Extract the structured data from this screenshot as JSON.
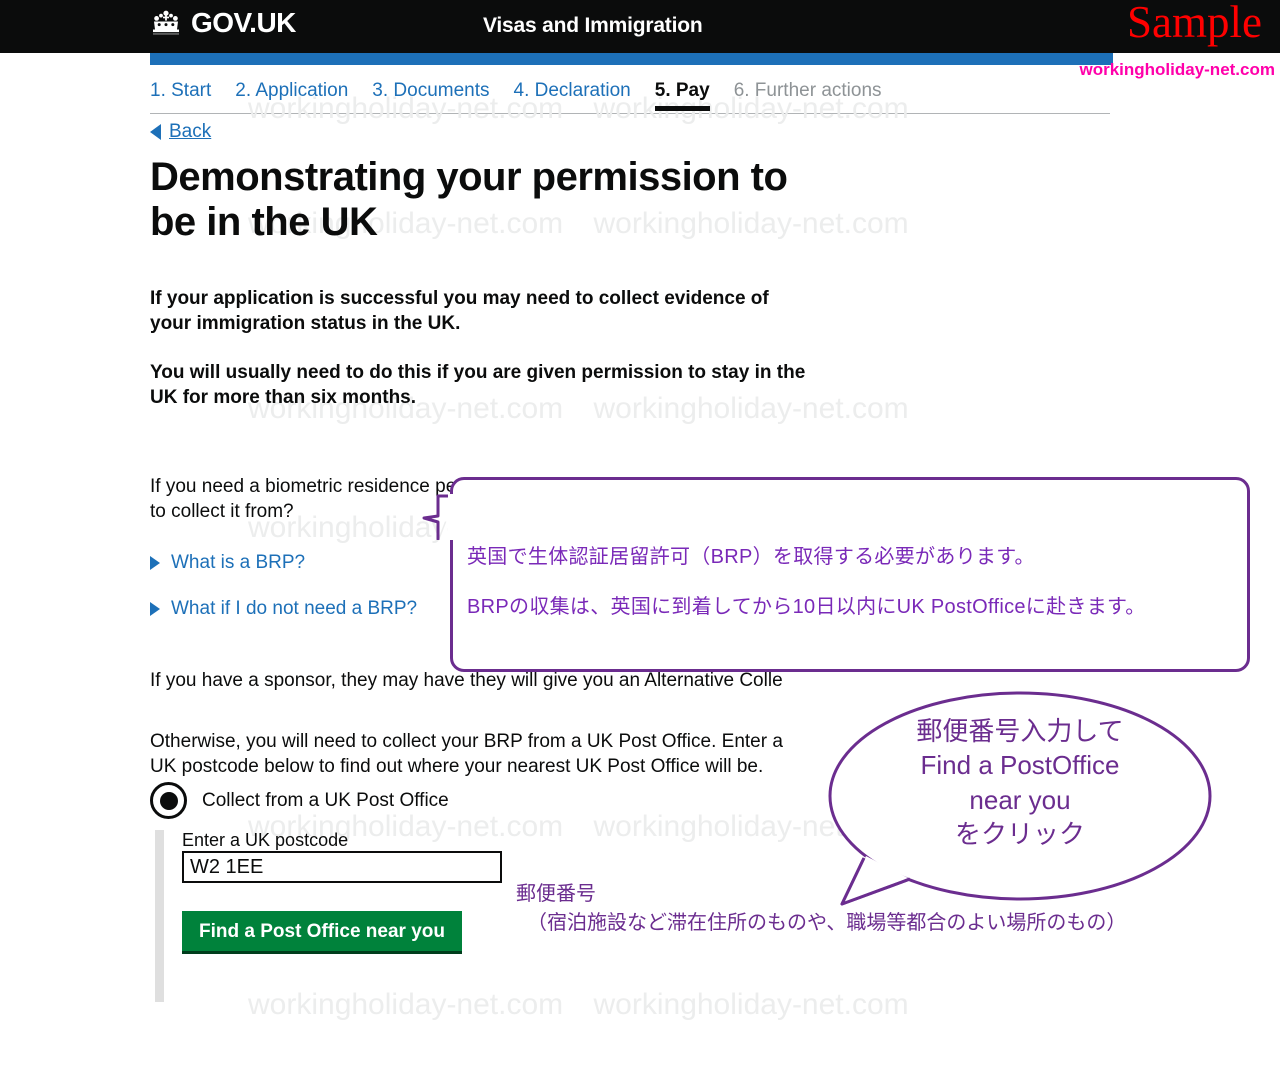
{
  "header": {
    "brand": "GOV.UK",
    "crown_icon": "crown-icon",
    "service_name": "Visas and Immigration",
    "sample_watermark": "Sample",
    "site_watermark": "workingholiday-net.com",
    "brand_bar_color": "#1d70b8",
    "header_bg": "#0b0c0c",
    "sample_color": "#ff0000",
    "site_mark_color": "#ff00aa"
  },
  "steps": [
    {
      "label": "1. Start",
      "state": "link"
    },
    {
      "label": "2. Application",
      "state": "link"
    },
    {
      "label": "3. Documents",
      "state": "link"
    },
    {
      "label": "4. Declaration",
      "state": "link"
    },
    {
      "label": "5. Pay",
      "state": "current"
    },
    {
      "label": "6. Further actions",
      "state": "muted"
    }
  ],
  "back": {
    "label": "Back",
    "arrow_icon": "triangle-left-icon"
  },
  "main": {
    "title": "Demonstrating your permission to be in the UK",
    "lead1": "If your application is successful you may need to collect evidence of your immigration status in the UK.",
    "lead2": "You will usually need to do this if you are given permission to stay in the UK for more than six months.",
    "question": "If you need a biometric residence permit (BRP) in the UK, where do you want to collect it from?",
    "details": [
      {
        "label": "What is a BRP?",
        "icon": "triangle-right-icon"
      },
      {
        "label": "What if I do not need a BRP?",
        "icon": "triangle-right-icon"
      }
    ],
    "sponsor_text": "If you have a sponsor, they may have they will give you an Alternative Colle",
    "otherwise_text": "Otherwise, you will need to collect your BRP from a UK Post Office. Enter a UK postcode below to find out where your nearest UK Post Office will be."
  },
  "form": {
    "radio_label": "Collect from a UK Post Office",
    "radio_selected": true,
    "postcode_label": "Enter a UK postcode",
    "postcode_value": "W2 1EE",
    "postcode_placeholder": "",
    "submit_label": "Find a Post Office near you",
    "submit_color": "#00823b"
  },
  "annotations": {
    "accent_color": "#6b2d8f",
    "callout": {
      "line1": "英国で生体認証居留許可（BRP）を取得する必要があります。",
      "line2": "BRPの収集は、英国に到着してから10日以内にUK PostOfficeに赴きます。"
    },
    "postcode_note": {
      "line1": "郵便番号",
      "line2": "（宿泊施設など滞在住所のものや、職場等都合のよい場所のもの）"
    },
    "bubble": {
      "line1": "郵便番号入力して",
      "line2": "Find a PostOffice",
      "line3": "near you",
      "line4": "をクリック"
    }
  },
  "watermark": {
    "text": "workingholiday-net.com",
    "color": "#eceded"
  }
}
